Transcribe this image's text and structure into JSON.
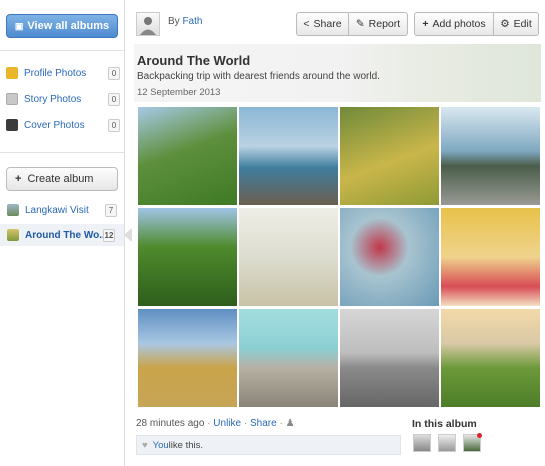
{
  "sidebar": {
    "view_all": "View all albums",
    "items": [
      {
        "label": "Profile Photos",
        "count": "0",
        "color": "#e8b628"
      },
      {
        "label": "Story Photos",
        "count": "0",
        "color": "#c8c8c8"
      },
      {
        "label": "Cover Photos",
        "count": "0",
        "color": "#3b3b3b"
      }
    ],
    "create_album": "Create album",
    "albums": [
      {
        "label": "Langkawi Visit",
        "count": "7"
      },
      {
        "label": "Around The Wo...",
        "count": "12"
      }
    ]
  },
  "header": {
    "by_prefix": "By",
    "author": "Fath",
    "share": "Share",
    "report": "Report",
    "add_photos": "Add photos",
    "edit": "Edit"
  },
  "album": {
    "title": "Around The World",
    "description": "Backpacking trip with dearest friends around the world.",
    "date": "12 September 2013"
  },
  "footer": {
    "time": "28 minutes ago",
    "sep": "·",
    "unlike": "Unlike",
    "share": "Share",
    "like_you": "You",
    "like_text": " like this.",
    "in_album": "In this album"
  },
  "colors": {
    "accent": "#2a6ab8",
    "primary_button": "#5c96d6"
  }
}
